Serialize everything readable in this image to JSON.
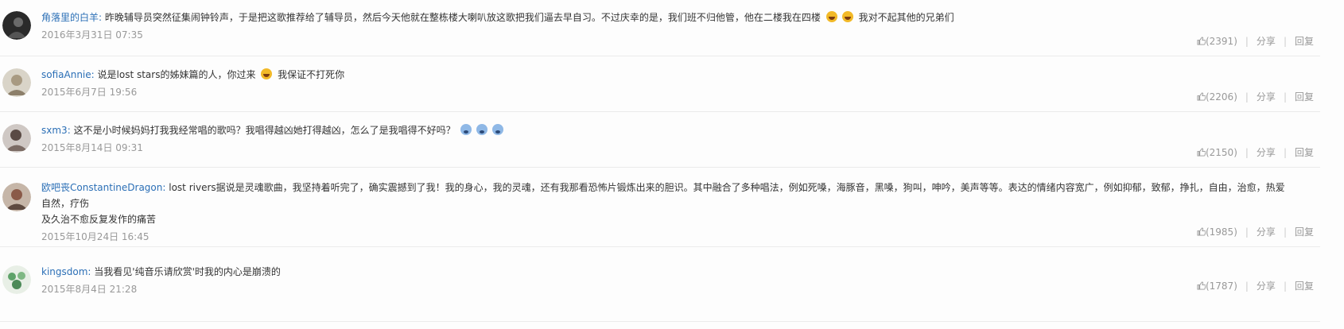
{
  "comments": [
    {
      "author": "角落里的白羊",
      "text": "昨晚辅导员突然征集闹钟铃声，于是把这歌推荐给了辅导员，然后今天他就在整栋楼大喇叭放这歌把我们逼去早自习。不过庆幸的是，我们班不归他管，他在二楼我在四楼",
      "text2": "我对不起其他的兄弟们",
      "date": "2016年3月31日 07:35",
      "likes": "(2391)",
      "share": "分享",
      "reply": "回复"
    },
    {
      "author": "sofiaAnnie",
      "text": "说是lost stars的姊妹篇的人，你过来",
      "text2": "我保证不打死你",
      "date": "2015年6月7日 19:56",
      "likes": "(2206)",
      "share": "分享",
      "reply": "回复"
    },
    {
      "author": "sxm3",
      "text": "这不是小时候妈妈打我我经常唱的歌吗？我唱得越凶她打得越凶，怎么了是我唱得不好吗？",
      "date": "2015年8月14日 09:31",
      "likes": "(2150)",
      "share": "分享",
      "reply": "回复"
    },
    {
      "author": "欧吧丧ConstantineDragon",
      "text": "lost rivers据说是灵魂歌曲，我坚持着听完了，确实震撼到了我！我的身心，我的灵魂，还有我那看恐怖片锻炼出来的胆识。其中融合了多种唱法，例如死嗓，海豚音，黑嗓，狗叫，呻吟，美声等等。表达的情绪内容宽广，例如抑郁，致郁，挣扎，自由，治愈，热爱自然，疗伤",
      "text2": "及久治不愈反复发作的痛苦",
      "date": "2015年10月24日 16:45",
      "likes": "(1985)",
      "share": "分享",
      "reply": "回复"
    },
    {
      "author": "kingsdom",
      "text": "当我看见'纯音乐请欣赏'时我的内心是崩溃的",
      "date": "2015年8月4日 21:28",
      "likes": "(1787)",
      "share": "分享",
      "reply": "回复"
    }
  ]
}
